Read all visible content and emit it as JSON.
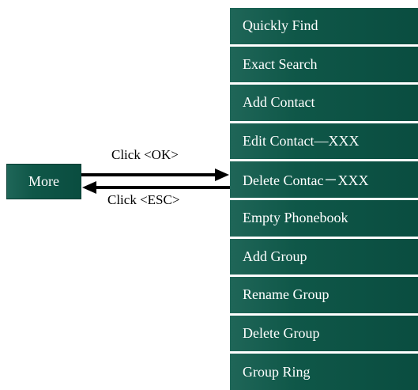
{
  "more_label": "More",
  "ok_label": "Click <OK>",
  "esc_label": "Click <ESC>",
  "menu_items": [
    "Quickly Find",
    "Exact Search",
    "Add Contact",
    "Edit Contact—XXX",
    "Delete Contac－XXX",
    "Empty Phonebook",
    "Add Group",
    "Rename Group",
    "Delete Group",
    "Group Ring"
  ],
  "colors": {
    "box_fill": "#0f5748",
    "box_text": "#ffffff",
    "arrow": "#000000"
  }
}
